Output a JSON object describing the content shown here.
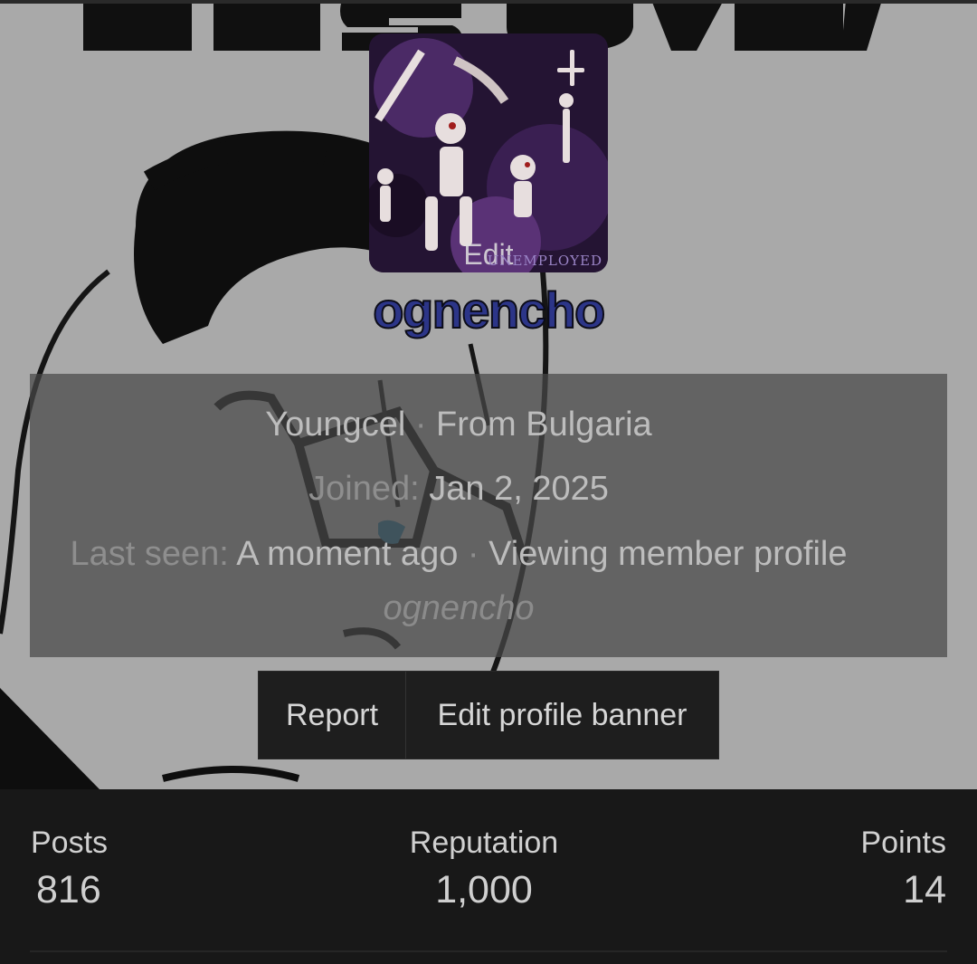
{
  "avatar": {
    "edit_label": "Edit",
    "tag_text": "UNEMPLOYED"
  },
  "user": {
    "username": "ognencho"
  },
  "info": {
    "title": "Youngcel",
    "separator": " · ",
    "location": "From Bulgaria",
    "joined_label": "Joined:",
    "joined_value": "Jan 2, 2025",
    "last_seen_label": "Last seen:",
    "last_seen_value": "A moment ago",
    "activity": "Viewing member profile",
    "activity_target": "ognencho"
  },
  "actions": {
    "report_label": "Report",
    "edit_banner_label": "Edit profile banner"
  },
  "stats": {
    "posts_label": "Posts",
    "posts_value": "816",
    "reputation_label": "Reputation",
    "reputation_value": "1,000",
    "points_label": "Points",
    "points_value": "14"
  },
  "colors": {
    "username": "#2c3588",
    "page_background": "#181818",
    "banner_background": "#a9a9a9"
  }
}
